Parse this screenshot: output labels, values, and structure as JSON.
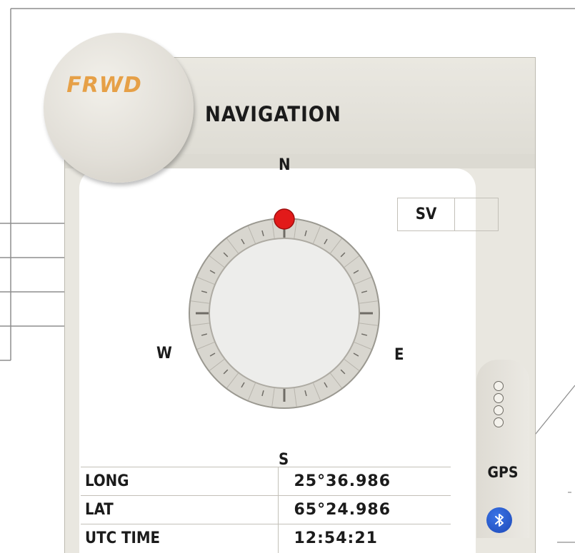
{
  "header": {
    "logo_text": "FRWD",
    "title": "NAVIGATION"
  },
  "compass": {
    "north": "N",
    "south": "S",
    "east": "E",
    "west": "W",
    "heading_marker_color": "#e21a1a"
  },
  "sv": {
    "label": "SV",
    "value": ""
  },
  "table": {
    "rows": [
      {
        "label": "LONG",
        "value": "25°36.986"
      },
      {
        "label": "LAT",
        "value": "65°24.986"
      },
      {
        "label": "UTC TIME",
        "value": "12:54:21"
      }
    ]
  },
  "gps": {
    "label": "GPS",
    "indicator_count": 4,
    "bluetooth_icon": "bluetooth-icon",
    "bluetooth_color": "#2454c9"
  },
  "colors": {
    "panel": "#e9e7e0",
    "logo": "#e6a047",
    "border": "#c3c0b8"
  }
}
